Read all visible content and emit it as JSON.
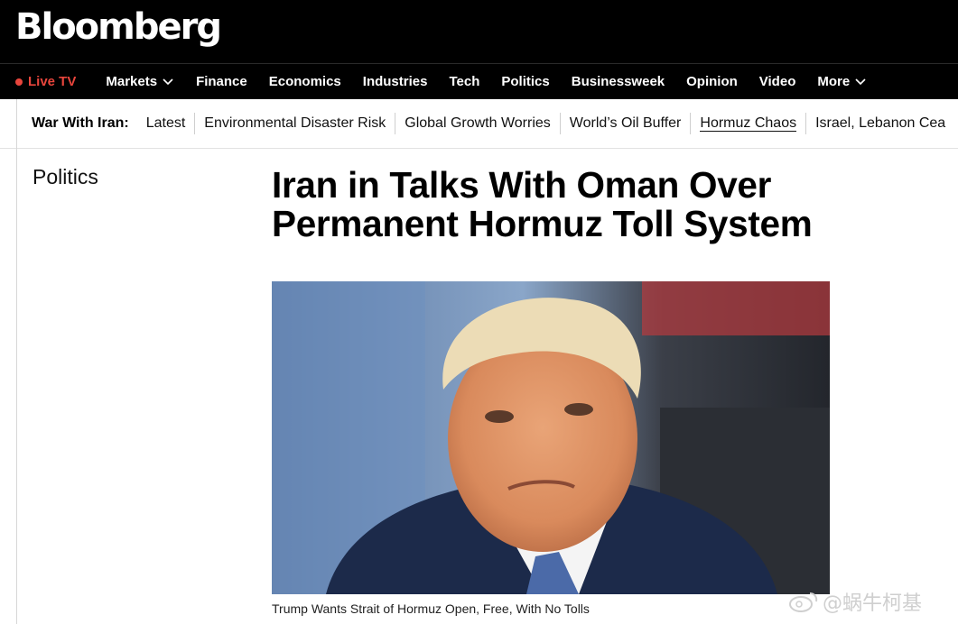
{
  "header": {
    "logo": "Bloomberg"
  },
  "nav": {
    "live": "Live TV",
    "items": [
      {
        "label": "Markets",
        "has_menu": true
      },
      {
        "label": "Finance"
      },
      {
        "label": "Economics"
      },
      {
        "label": "Industries"
      },
      {
        "label": "Tech"
      },
      {
        "label": "Politics"
      },
      {
        "label": "Businessweek"
      },
      {
        "label": "Opinion"
      },
      {
        "label": "Video"
      },
      {
        "label": "More",
        "has_menu": true
      }
    ]
  },
  "subnav": {
    "label": "War With Iran:",
    "links": [
      {
        "label": "Latest"
      },
      {
        "label": "Environmental Disaster Risk"
      },
      {
        "label": "Global Growth Worries"
      },
      {
        "label": "World’s Oil Buffer"
      },
      {
        "label": "Hormuz Chaos",
        "current": true
      },
      {
        "label": "Israel, Lebanon Cea"
      }
    ]
  },
  "article": {
    "section": "Politics",
    "headline_line1": "Iran in Talks With Oman Over",
    "headline_line2": "Permanent Hormuz Toll System",
    "caption": "Trump Wants Strait of Hormuz Open, Free, With No Tolls"
  },
  "watermark": {
    "text": "@蜗牛柯基"
  },
  "colors": {
    "live_red": "#e8453c",
    "bar_black": "#000000"
  }
}
